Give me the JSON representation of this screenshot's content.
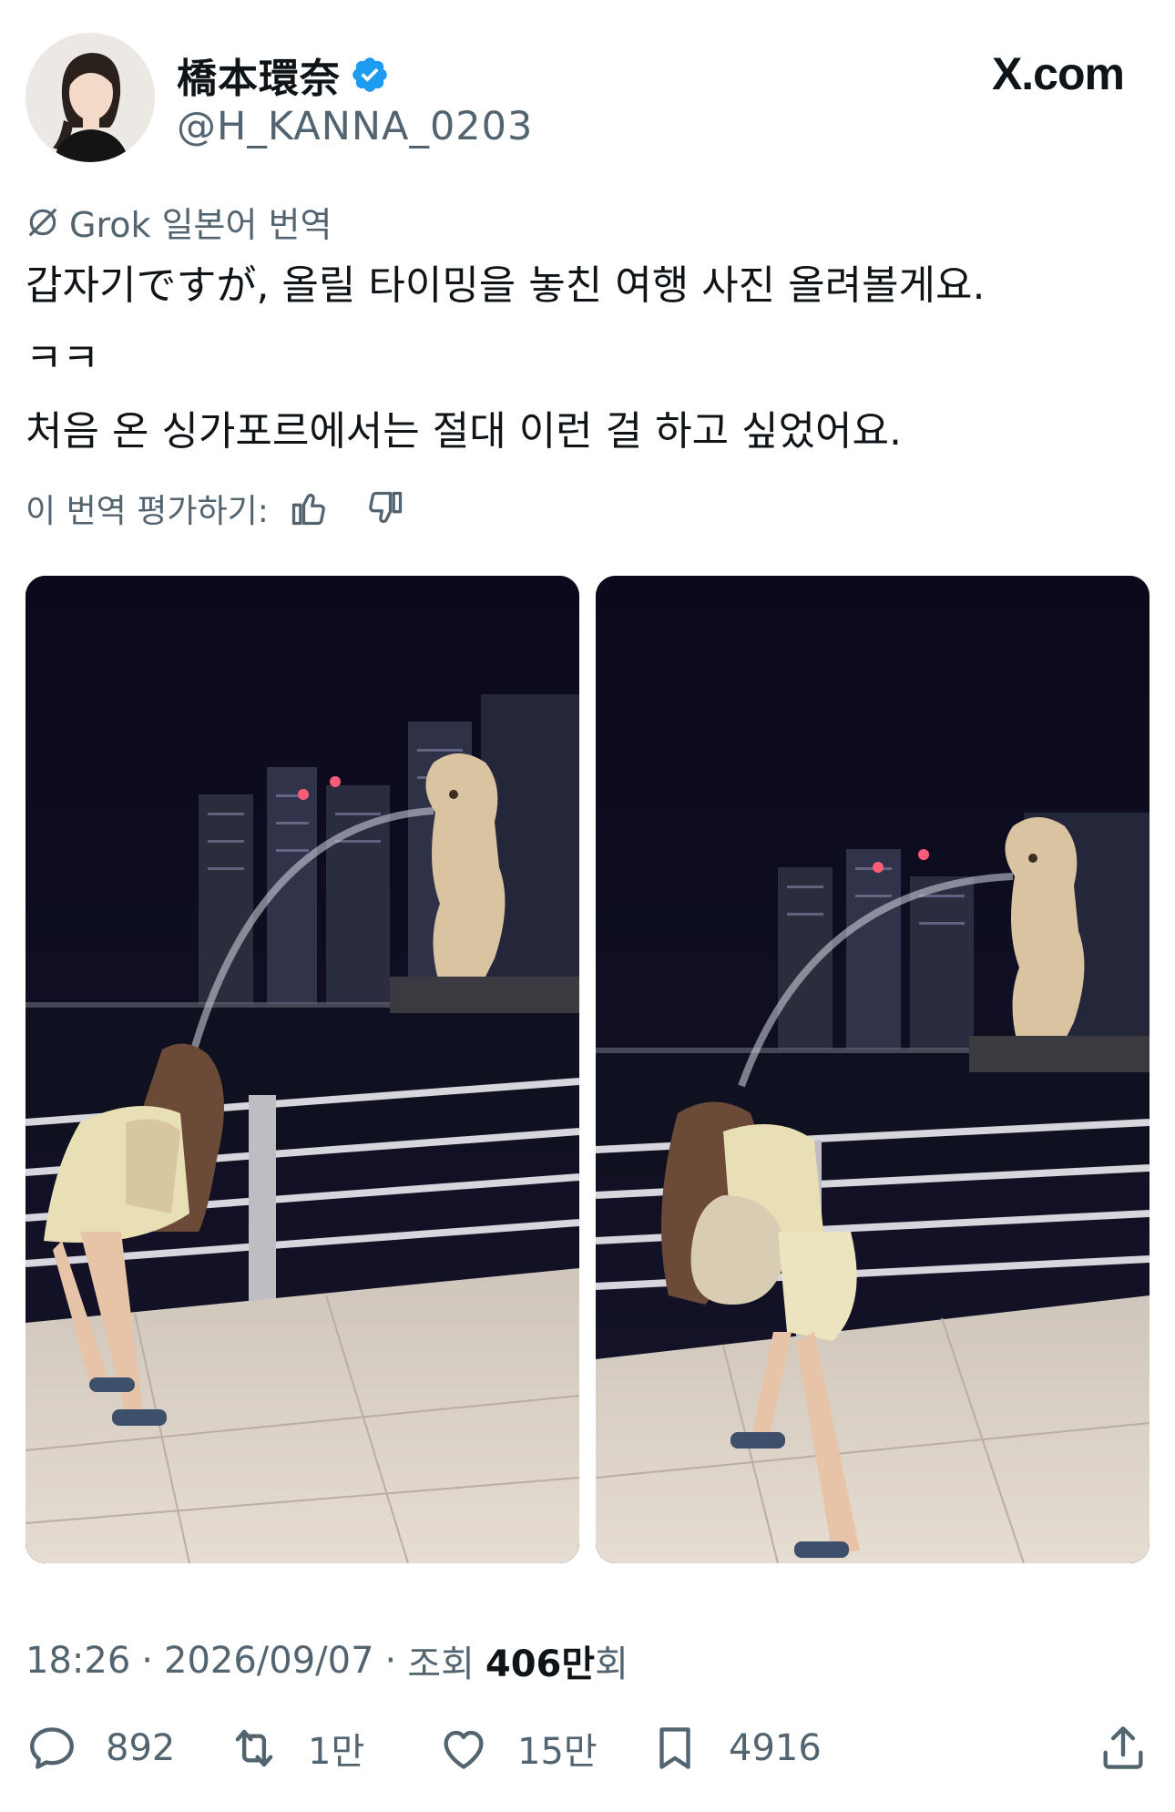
{
  "author": {
    "display_name": "橋本環奈",
    "handle": "@H_KANNA_0203",
    "verified": true
  },
  "brand": "X.com",
  "translation": {
    "label": "Grok 일본어 번역",
    "rate_label": "이 번역 평가하기:"
  },
  "tweet": {
    "lines": [
      "갑자기ですが, 올릴 타이밍을 놓친 여행 사진 올려볼게요.",
      "ㅋㅋ",
      "처음 온 싱가포르에서는 절대 이런 걸 하고 싶었어요."
    ]
  },
  "meta": {
    "time": "18:26",
    "date": "2026/09/07",
    "views_label": "조회",
    "views_count": "406만",
    "views_suffix": "회"
  },
  "actions": {
    "replies": "892",
    "retweets": "1만",
    "likes": "15만",
    "bookmarks": "4916"
  },
  "colors": {
    "text": "#0f1419",
    "secondary": "#536471",
    "verified": "#1d9bf0"
  },
  "icons": [
    "grok-icon",
    "thumbs-up-icon",
    "thumbs-down-icon",
    "reply-icon",
    "retweet-icon",
    "like-icon",
    "bookmark-icon",
    "share-icon",
    "verified-icon"
  ]
}
